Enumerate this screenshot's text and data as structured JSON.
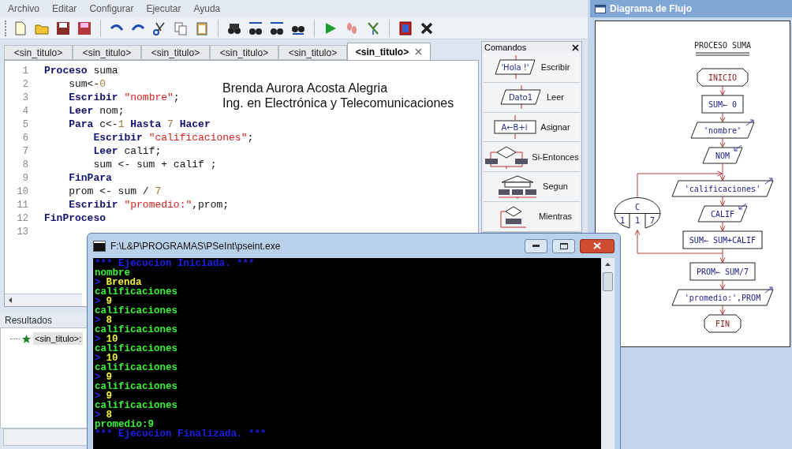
{
  "menu": [
    "Archivo",
    "Editar",
    "Configurar",
    "Ejecutar",
    "Ayuda"
  ],
  "tabs": [
    {
      "label": "<sin_titulo>",
      "selected": false
    },
    {
      "label": "<sin_titulo>",
      "selected": false
    },
    {
      "label": "<sin_titulo>",
      "selected": false
    },
    {
      "label": "<sin_titulo>",
      "selected": false
    },
    {
      "label": "<sin_titulo>",
      "selected": false
    },
    {
      "label": "<sin_titulo>",
      "selected": true
    }
  ],
  "editor": {
    "lines": [
      {
        "number": "1",
        "tokens": [
          {
            "kind": "keyword",
            "text": "Proceso"
          },
          {
            "kind": "plain",
            "text": " suma"
          }
        ]
      },
      {
        "number": "2",
        "tokens": [
          {
            "kind": "plain",
            "text": "    sum<-"
          },
          {
            "kind": "number",
            "text": "0"
          }
        ]
      },
      {
        "number": "3",
        "tokens": [
          {
            "kind": "keyword",
            "text": "    Escribir"
          },
          {
            "kind": "string",
            "text": " \"nombre\""
          },
          {
            "kind": "plain",
            "text": ";"
          }
        ]
      },
      {
        "number": "4",
        "tokens": [
          {
            "kind": "keyword",
            "text": "    Leer"
          },
          {
            "kind": "plain",
            "text": " nom;"
          }
        ]
      },
      {
        "number": "5",
        "tokens": [
          {
            "kind": "keyword",
            "text": "    Para"
          },
          {
            "kind": "plain",
            "text": " c<-"
          },
          {
            "kind": "number",
            "text": "1"
          },
          {
            "kind": "keyword",
            "text": " Hasta"
          },
          {
            "kind": "number",
            "text": " 7"
          },
          {
            "kind": "keyword",
            "text": " Hacer"
          }
        ]
      },
      {
        "number": "6",
        "tokens": [
          {
            "kind": "keyword",
            "text": "        Escribir"
          },
          {
            "kind": "string",
            "text": " \"calificaciones\""
          },
          {
            "kind": "plain",
            "text": ";"
          }
        ]
      },
      {
        "number": "7",
        "tokens": [
          {
            "kind": "keyword",
            "text": "        Leer"
          },
          {
            "kind": "plain",
            "text": " calif;"
          }
        ]
      },
      {
        "number": "8",
        "tokens": [
          {
            "kind": "plain",
            "text": "        sum <- sum + calif ;"
          }
        ]
      },
      {
        "number": "9",
        "tokens": [
          {
            "kind": "keyword",
            "text": "    FinPara"
          }
        ]
      },
      {
        "number": "10",
        "tokens": [
          {
            "kind": "plain",
            "text": "    prom <- sum / "
          },
          {
            "kind": "number",
            "text": "7"
          }
        ]
      },
      {
        "number": "11",
        "tokens": [
          {
            "kind": "keyword",
            "text": "    Escribir"
          },
          {
            "kind": "string",
            "text": " \"promedio:\""
          },
          {
            "kind": "plain",
            "text": ",prom;"
          }
        ]
      },
      {
        "number": "12",
        "tokens": [
          {
            "kind": "keyword",
            "text": "FinProceso"
          }
        ]
      },
      {
        "number": "13"
      }
    ],
    "annotation": [
      "Brenda Aurora Acosta Alegria",
      "Ing. en Electrónica y Telecomunicaciones"
    ]
  },
  "commands": {
    "title": "Comandos",
    "items": [
      {
        "kind": "output",
        "label": "Escribir",
        "sample": "'Hola !'"
      },
      {
        "kind": "input",
        "label": "Leer",
        "sample": "Dato1"
      },
      {
        "kind": "assign",
        "label": "Asignar",
        "sample": "A←B+i"
      },
      {
        "kind": "if",
        "label": "Si-Entonces"
      },
      {
        "kind": "switch",
        "label": "Segun"
      },
      {
        "kind": "while",
        "label": "Mientras"
      }
    ]
  },
  "results": {
    "title": "Resultados",
    "items": [
      "<sin_titulo>:"
    ]
  },
  "console": {
    "title": "F:\\L&P\\PROGRAMAS\\PSeInt\\pseint.exe",
    "lines": [
      {
        "kind": "banner",
        "text": "*** Ejecucion Iniciada. ***"
      },
      {
        "kind": "output",
        "text": "nombre"
      },
      {
        "kind": "input",
        "prompt": ">",
        "text": "Brenda"
      },
      {
        "kind": "output",
        "text": "calificaciones"
      },
      {
        "kind": "input",
        "prompt": ">",
        "text": "9"
      },
      {
        "kind": "output",
        "text": "calificaciones"
      },
      {
        "kind": "input",
        "prompt": ">",
        "text": "8"
      },
      {
        "kind": "output",
        "text": "calificaciones"
      },
      {
        "kind": "input",
        "prompt": ">",
        "text": "10"
      },
      {
        "kind": "output",
        "text": "calificaciones"
      },
      {
        "kind": "input",
        "prompt": ">",
        "text": "10"
      },
      {
        "kind": "output",
        "text": "calificaciones"
      },
      {
        "kind": "input",
        "prompt": ">",
        "text": "9"
      },
      {
        "kind": "output",
        "text": "calificaciones"
      },
      {
        "kind": "input",
        "prompt": ">",
        "text": "9"
      },
      {
        "kind": "output",
        "text": "calificaciones"
      },
      {
        "kind": "input",
        "prompt": ">",
        "text": "8"
      },
      {
        "kind": "output",
        "text": "promedio:9"
      },
      {
        "kind": "banner",
        "text": "*** Ejecucion Finalizada. ***"
      }
    ]
  },
  "flowchart": {
    "title": "Diagrama de Flujo",
    "heading": "PROCESO SUMA",
    "nodes": [
      {
        "kind": "terminal",
        "text": "INICIO"
      },
      {
        "kind": "process",
        "text": "SUM← 0"
      },
      {
        "kind": "output",
        "text": "'nombre'"
      },
      {
        "kind": "input",
        "text": "NOM"
      },
      {
        "kind": "loop",
        "variable": "C",
        "values": [
          "1",
          "1",
          "7"
        ],
        "children": [
          {
            "kind": "output",
            "text": "'calificaciones'"
          },
          {
            "kind": "input",
            "text": "CALIF"
          },
          {
            "kind": "process",
            "text": "SUM← SUM+CALIF"
          }
        ]
      },
      {
        "kind": "process",
        "text": "PROM← SUM/7"
      },
      {
        "kind": "output",
        "text": "'promedio:',PROM"
      },
      {
        "kind": "terminal",
        "text": "FIN"
      }
    ]
  }
}
